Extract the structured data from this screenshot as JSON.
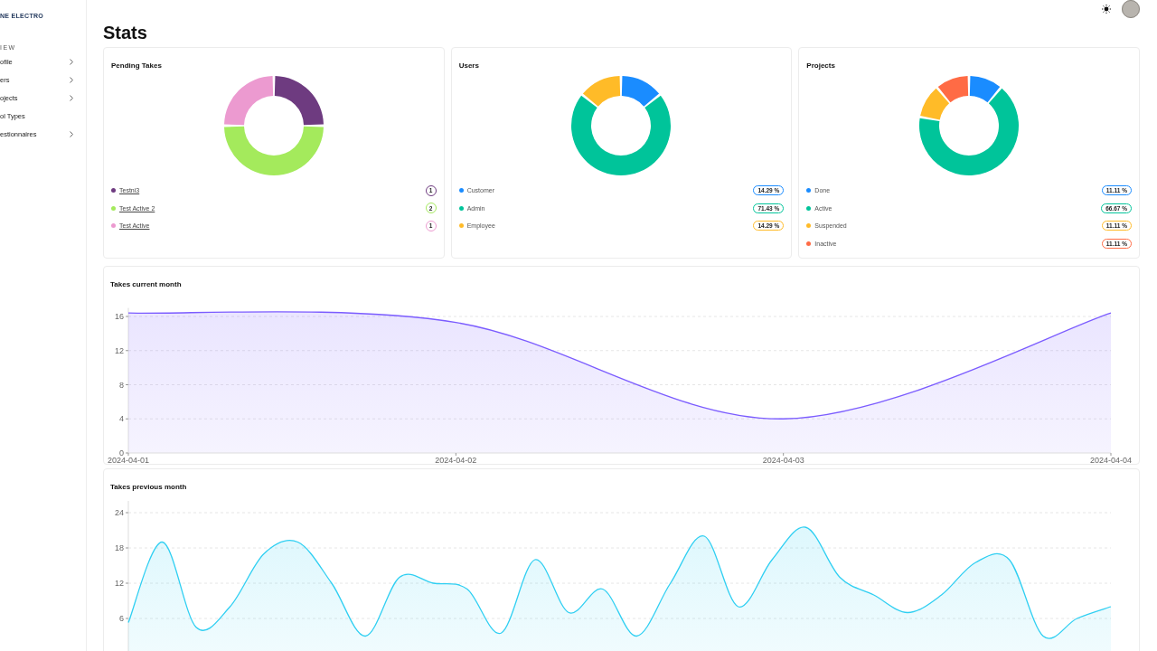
{
  "sidebar": {
    "logo": "NE ELECTRO",
    "section": "IEW",
    "items": [
      {
        "label": "ofile",
        "expandable": true
      },
      {
        "label": "ers",
        "expandable": true
      },
      {
        "label": "ojects",
        "expandable": true
      },
      {
        "label": "ol Types",
        "expandable": false
      },
      {
        "label": "estionnaires",
        "expandable": true
      }
    ]
  },
  "page": {
    "title": "Stats"
  },
  "donut_cards": [
    {
      "title": "Pending Takes",
      "kind": "count",
      "chart_data": {
        "type": "donut",
        "categories": [
          "Testni3",
          "Test Active 2",
          "Test Active"
        ],
        "values": [
          1,
          2,
          1
        ]
      },
      "legend": [
        {
          "value": "1",
          "color": "#6e3b80"
        },
        {
          "value": "2",
          "color": "#a4ea5c"
        },
        {
          "value": "1",
          "color": "#ec9ad0"
        }
      ]
    },
    {
      "title": "Users",
      "kind": "percent",
      "chart_data": {
        "type": "donut",
        "categories": [
          "Customer",
          "Admin",
          "Employee"
        ],
        "values": [
          14.29,
          71.43,
          14.29
        ]
      },
      "legend": [
        {
          "value": "14.29 %",
          "color": "#1a8cff"
        },
        {
          "value": "71.43 %",
          "color": "#00c49a"
        },
        {
          "value": "14.29 %",
          "color": "#ffbb28"
        }
      ]
    },
    {
      "title": "Projects",
      "kind": "percent",
      "chart_data": {
        "type": "donut",
        "categories": [
          "Done",
          "Active",
          "Suspended",
          "Inactive"
        ],
        "values": [
          11.11,
          66.67,
          11.11,
          11.11
        ]
      },
      "legend": [
        {
          "value": "11.11 %",
          "color": "#1a8cff"
        },
        {
          "value": "66.67 %",
          "color": "#00c49a"
        },
        {
          "value": "11.11 %",
          "color": "#ffbb28"
        },
        {
          "value": "11.11 %",
          "color": "#ff6b45"
        }
      ]
    }
  ],
  "line_cards": [
    {
      "title": "Takes current month",
      "chart_data": {
        "type": "area",
        "categories": [
          "2024-04-01",
          "2024-04-02",
          "2024-04-03",
          "2024-04-04"
        ],
        "series": [
          {
            "color": "#7b5cff",
            "values": [
              16.4,
              15.3,
              4,
              16.4
            ]
          }
        ],
        "ylim": [
          0,
          17
        ],
        "yticks": [
          0,
          4,
          8,
          12,
          16
        ],
        "grid": true
      }
    },
    {
      "title": "Takes previous month",
      "chart_data": {
        "type": "area",
        "series": [
          {
            "color": "#2fcff2",
            "values": [
              5.3,
              19,
              4.5,
              8,
              17,
              19,
              12,
              3,
              13,
              12,
              11,
              3.5,
              16,
              7,
              11,
              3,
              12,
              20,
              8,
              16,
              21.5,
              13,
              10,
              7,
              10,
              15.5,
              16,
              3,
              6,
              8
            ]
          }
        ],
        "ylim": [
          0,
          26
        ],
        "yticks": [
          6,
          12,
          18,
          24
        ],
        "grid": true
      }
    }
  ]
}
